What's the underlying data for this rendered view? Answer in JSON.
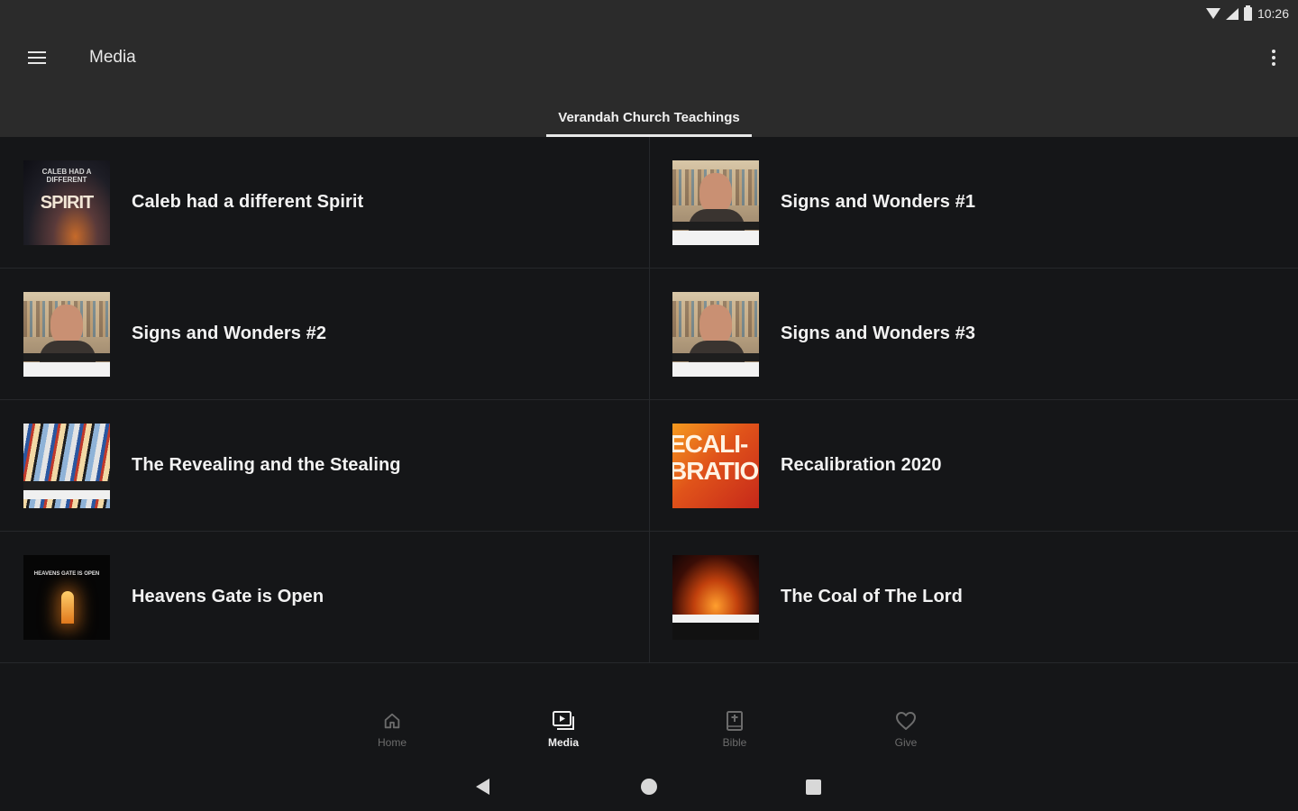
{
  "status_bar": {
    "time": "10:26"
  },
  "app_bar": {
    "title": "Media"
  },
  "tabs": [
    {
      "label": "Verandah Church Teachings",
      "selected": true
    }
  ],
  "media_items": [
    {
      "title": "Caleb had a different Spirit",
      "thumb_text_small": "CALEB HAD A DIFFERENT",
      "thumb_text_large": "SPIRIT"
    },
    {
      "title": "Signs and Wonders #1"
    },
    {
      "title": "Signs and Wonders #2"
    },
    {
      "title": "Signs and Wonders #3"
    },
    {
      "title": "The Revealing and the Stealing"
    },
    {
      "title": "Recalibration 2020",
      "thumb_text": "ECALI-BRATIO"
    },
    {
      "title": "Heavens Gate is Open",
      "thumb_text": "HEAVENS GATE IS OPEN"
    },
    {
      "title": "The Coal of The Lord"
    }
  ],
  "bottom_nav": [
    {
      "label": "Home",
      "icon": "home-icon",
      "active": false
    },
    {
      "label": "Media",
      "icon": "media-icon",
      "active": true
    },
    {
      "label": "Bible",
      "icon": "bible-icon",
      "active": false
    },
    {
      "label": "Give",
      "icon": "heart-icon",
      "active": false
    }
  ],
  "colors": {
    "app_bar": "#2b2b2b",
    "background": "#151618",
    "inactive_nav": "#6c6c6c",
    "active_nav": "#f0f0f0"
  }
}
